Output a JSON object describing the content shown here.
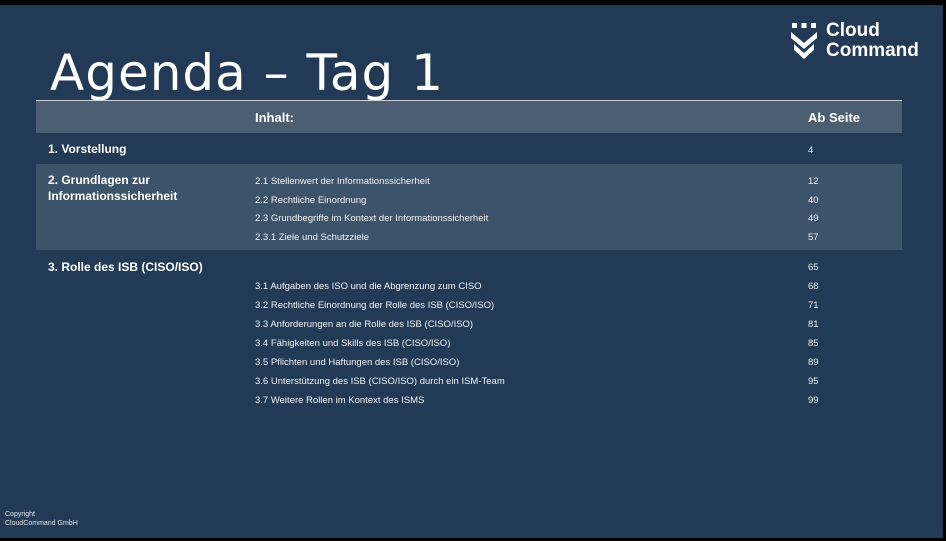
{
  "slide": {
    "title": "Agenda – Tag 1",
    "logo": {
      "line1": "Cloud",
      "line2": "Command",
      "icon": "cloudcommand-shield-icon"
    },
    "table": {
      "header": {
        "content": "Inhalt:",
        "page": "Ab Seite"
      },
      "sections": [
        {
          "title": "1. Vorstellung",
          "page": "4",
          "items": []
        },
        {
          "title_line1": "2. Grundlagen zur",
          "title_line2": "Informationssicherheit",
          "items": [
            {
              "label": "2.1 Stellenwert der Informationssicherheit",
              "page": "12"
            },
            {
              "label": "2.2 Rechtliche Einordnung",
              "page": "40"
            },
            {
              "label": "2.3 Grundbegriffe im Kontext der Informationssicherheit",
              "page": "49"
            },
            {
              "label": "2.3.1 Ziele und Schutzziele",
              "page": "57"
            }
          ]
        },
        {
          "title": "3. Rolle des ISB (CISO/ISO)",
          "page": "65",
          "items": [
            {
              "label": "3.1 Aufgaben des ISO und die Abgrenzung zum CISO",
              "page": "68"
            },
            {
              "label": "3.2 Rechtliche Einordnung der Rolle des ISB (CISO/ISO)",
              "page": "71"
            },
            {
              "label": "3.3 Anforderungen an die Rolle des ISB (CISO/ISO)",
              "page": "81"
            },
            {
              "label": "3.4 Fähigkeiten und Skills des ISB (CISO/ISO)",
              "page": "85"
            },
            {
              "label": "3.5 Pflichten und Haftungen des ISB (CISO/ISO)",
              "page": "89"
            },
            {
              "label": "3.6 Unterstützung des ISB (CISO/ISO) durch ein ISM-Team",
              "page": "95"
            },
            {
              "label": "3.7 Weitere Rollen im Kontext des ISMS",
              "page": "99"
            }
          ]
        }
      ]
    },
    "footer": {
      "line1": "Copyright",
      "line2": "CloudCommand GmbH"
    },
    "colors": {
      "background": "#223a56",
      "header_band": "#4c5f72",
      "alt_band": "#3d536a"
    }
  }
}
